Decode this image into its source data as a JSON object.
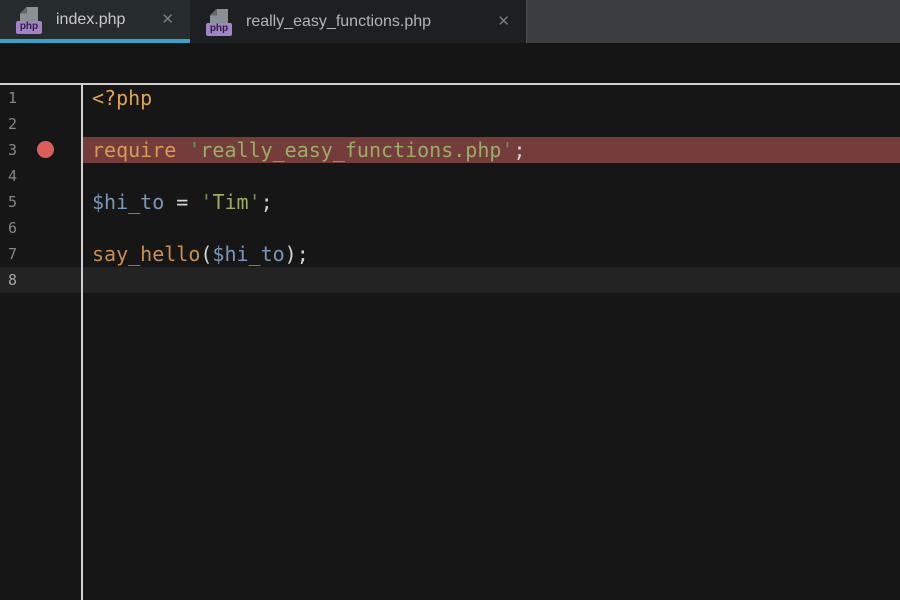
{
  "tab_bar": {
    "close_glyph": "✕",
    "tabs": [
      {
        "label": "index.php",
        "file_type_badge": "php",
        "active": true
      },
      {
        "label": "really_easy_functions.php",
        "file_type_badge": "php",
        "active": false
      }
    ]
  },
  "editor": {
    "line_count": 8,
    "breakpoint_line": 3,
    "breakpoint_highlight_line": 3,
    "caret_line": 8,
    "lines": [
      {
        "n": "1",
        "tokens": [
          [
            "<?php",
            "tag"
          ]
        ]
      },
      {
        "n": "2",
        "tokens": []
      },
      {
        "n": "3",
        "tokens": [
          [
            "require",
            "kw"
          ],
          [
            " ",
            "pl"
          ],
          [
            "'",
            "q"
          ],
          [
            "really_easy_functions.php",
            "str"
          ],
          [
            "'",
            "q"
          ],
          [
            ";",
            "pl"
          ]
        ]
      },
      {
        "n": "4",
        "tokens": []
      },
      {
        "n": "5",
        "tokens": [
          [
            "$hi_to",
            "var"
          ],
          [
            " ",
            "pl"
          ],
          [
            "=",
            "pl"
          ],
          [
            " ",
            "pl"
          ],
          [
            "'",
            "q"
          ],
          [
            "Tim",
            "str"
          ],
          [
            "'",
            "q"
          ],
          [
            ";",
            "pl"
          ]
        ]
      },
      {
        "n": "6",
        "tokens": []
      },
      {
        "n": "7",
        "tokens": [
          [
            "say_hello",
            "fn"
          ],
          [
            "(",
            "pl"
          ],
          [
            "$hi_to",
            "var"
          ],
          [
            ")",
            "pl"
          ],
          [
            ";",
            "pl"
          ]
        ]
      },
      {
        "n": "8",
        "tokens": []
      }
    ]
  },
  "colors": {
    "tab-bar-bg": "#3B3E41",
    "tab-active-bg": "#262B2E",
    "tab-inactive-bg": "#1D2022",
    "tab-underline": "#39A2C7",
    "tab-label-active": "#C8CBCD",
    "tab-label-inactive": "#B2B5B7",
    "close-icon": "#787D80",
    "php-badge-bg": "#A383C6",
    "php-badge-text": "#2B2140",
    "file-page": "#8A9095",
    "editor-bg": "#161616",
    "top-separator": "#CDCDCD",
    "gutter-line": "#D2D2D2",
    "line-number": "#85888A",
    "line-number-current": "#A2A5A7",
    "current-line-bg": "#232323",
    "breakpoint-line-bg": "#743D3C",
    "breakpoint-dot": "#DA5F5B",
    "tok-tag": "#DFA355",
    "tok-kw": "#D89A55",
    "tok-str": "#9CAC66",
    "tok-q": "#6F8F55",
    "tok-var": "#7C96B8",
    "tok-fn": "#C98E55",
    "tok-pl": "#D6D6D6"
  }
}
